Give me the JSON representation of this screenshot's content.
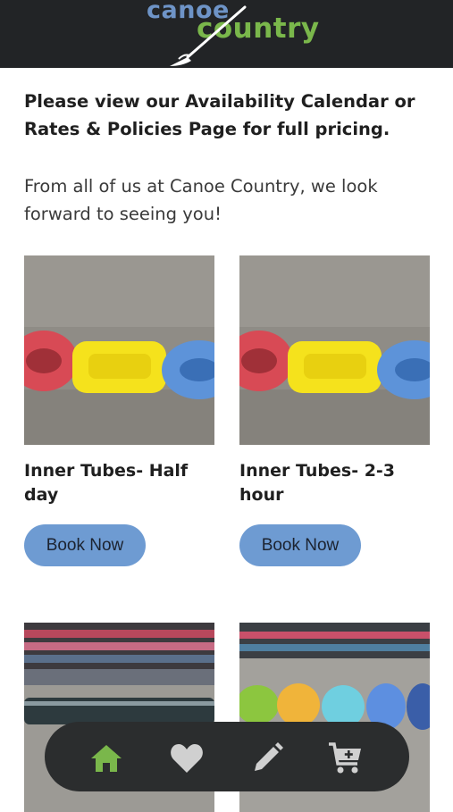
{
  "header": {
    "logo_word1": "canoe",
    "logo_word2": "country"
  },
  "intro": {
    "bold_text": "Please view our Availability Calendar or Rates & Policies Page for full pricing.",
    "text": "From all of us at Canoe Country, we look forward to seeing you!"
  },
  "products": [
    {
      "title": "Inner Tubes- Half day",
      "button": "Book Now",
      "image": "inner-tubes-photo"
    },
    {
      "title": "Inner Tubes- 2-3 hour",
      "button": "Book Now",
      "image": "inner-tubes-photo"
    },
    {
      "image": "canoes-photo"
    },
    {
      "image": "kayaks-photo"
    }
  ],
  "bottom_nav": [
    {
      "icon": "home-icon",
      "color": "#7ab74b"
    },
    {
      "icon": "heart-icon",
      "color": "#d0d0d0"
    },
    {
      "icon": "pencil-icon",
      "color": "#d0d0d0"
    },
    {
      "icon": "cart-plus-icon",
      "color": "#d0d0d0"
    }
  ]
}
